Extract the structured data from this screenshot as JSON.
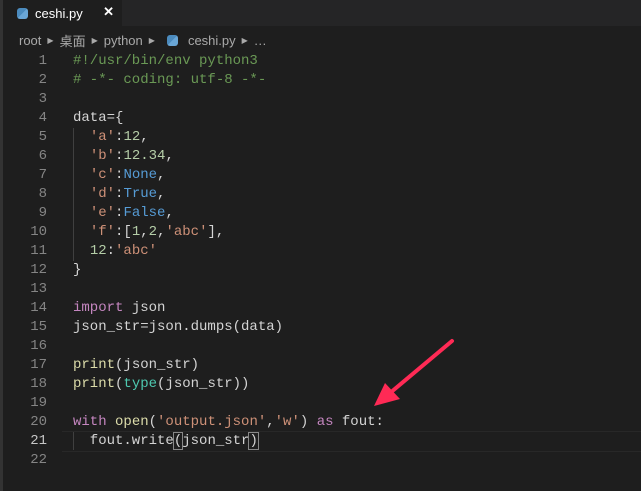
{
  "tab": {
    "filename": "ceshi.py",
    "close": "✕"
  },
  "breadcrumb": [
    "root",
    "桌面",
    "python",
    "ceshi.py",
    "…"
  ],
  "current_line": 21,
  "accent": "#ff2a55",
  "lines": [
    [
      [
        "#!/usr/bin/env python3",
        "cm"
      ]
    ],
    [
      [
        "# -*- coding: utf-8 -*-",
        "cm"
      ]
    ],
    [],
    [
      [
        "data={",
        ""
      ]
    ],
    [
      [
        "  ",
        ""
      ],
      [
        "'a'",
        "str"
      ],
      [
        ":",
        ""
      ],
      [
        "12",
        "num"
      ],
      [
        ",",
        ""
      ]
    ],
    [
      [
        "  ",
        ""
      ],
      [
        "'b'",
        "str"
      ],
      [
        ":",
        ""
      ],
      [
        "12.34",
        "num"
      ],
      [
        ",",
        ""
      ]
    ],
    [
      [
        "  ",
        ""
      ],
      [
        "'c'",
        "str"
      ],
      [
        ":",
        ""
      ],
      [
        "None",
        "const"
      ],
      [
        ",",
        ""
      ]
    ],
    [
      [
        "  ",
        ""
      ],
      [
        "'d'",
        "str"
      ],
      [
        ":",
        ""
      ],
      [
        "True",
        "const"
      ],
      [
        ",",
        ""
      ]
    ],
    [
      [
        "  ",
        ""
      ],
      [
        "'e'",
        "str"
      ],
      [
        ":",
        ""
      ],
      [
        "False",
        "const"
      ],
      [
        ",",
        ""
      ]
    ],
    [
      [
        "  ",
        ""
      ],
      [
        "'f'",
        "str"
      ],
      [
        ":[",
        ""
      ],
      [
        "1",
        "num"
      ],
      [
        ",",
        ""
      ],
      [
        "2",
        "num"
      ],
      [
        ",",
        ""
      ],
      [
        "'abc'",
        "str"
      ],
      [
        "],",
        ""
      ]
    ],
    [
      [
        "  ",
        ""
      ],
      [
        "12",
        "num"
      ],
      [
        ":",
        ""
      ],
      [
        "'abc'",
        "str"
      ]
    ],
    [
      [
        "}",
        ""
      ]
    ],
    [],
    [
      [
        "import",
        "kw"
      ],
      [
        " json",
        ""
      ]
    ],
    [
      [
        "json_str=json.dumps(data)",
        ""
      ]
    ],
    [],
    [
      [
        "print",
        "fn"
      ],
      [
        "(json_str)",
        ""
      ]
    ],
    [
      [
        "print",
        "fn"
      ],
      [
        "(",
        ""
      ],
      [
        "type",
        "cls"
      ],
      [
        "(json_str))",
        ""
      ]
    ],
    [],
    [
      [
        "with",
        "kw"
      ],
      [
        " ",
        ""
      ],
      [
        "open",
        "fn"
      ],
      [
        "(",
        ""
      ],
      [
        "'output.json'",
        "str"
      ],
      [
        ",",
        ""
      ],
      [
        "'w'",
        "str"
      ],
      [
        ") ",
        ""
      ],
      [
        "as",
        "kw"
      ],
      [
        " fout:",
        ""
      ]
    ],
    [
      [
        "  fout.write",
        ""
      ],
      [
        "(",
        "br"
      ],
      [
        "json_str",
        ""
      ],
      [
        ")",
        "br"
      ],
      [
        "",
        "caret"
      ]
    ],
    []
  ]
}
